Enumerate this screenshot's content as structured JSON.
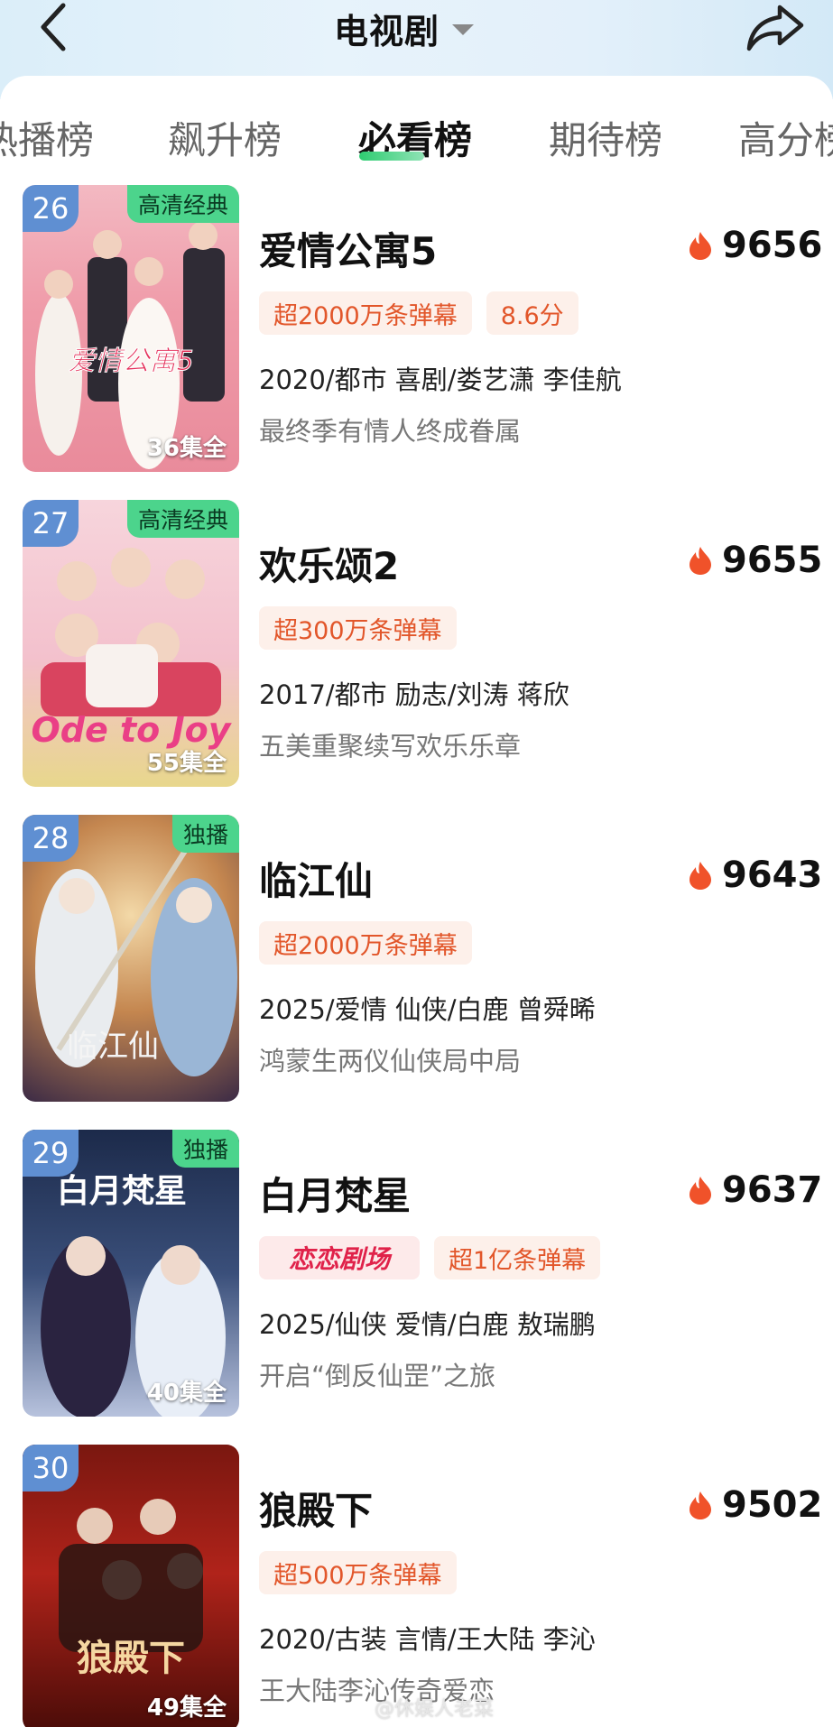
{
  "header": {
    "title": "电视剧"
  },
  "tabs": [
    {
      "label": "热播榜"
    },
    {
      "label": "飙升榜"
    },
    {
      "label": "必看榜"
    },
    {
      "label": "期待榜"
    },
    {
      "label": "高分榜"
    }
  ],
  "active_tab": "必看榜",
  "items": [
    {
      "rank": "26",
      "poster_tag": "高清经典",
      "episodes": "36集全",
      "name": "爱情公寓5",
      "hot": "9656",
      "tags": [
        "超2000万条弹幕",
        "8.6分"
      ],
      "meta": "2020/都市 喜剧/娄艺潇 李佳航",
      "desc": "最终季有情人终成眷属",
      "poster_caption": "爱情公寓5"
    },
    {
      "rank": "27",
      "poster_tag": "高清经典",
      "episodes": "55集全",
      "name": "欢乐颂2",
      "hot": "9655",
      "tags": [
        "超300万条弹幕"
      ],
      "meta": "2017/都市 励志/刘涛 蒋欣",
      "desc": "五美重聚续写欢乐乐章",
      "poster_caption": "Ode to Joy"
    },
    {
      "rank": "28",
      "poster_tag": "独播",
      "episodes": "",
      "name": "临江仙",
      "hot": "9643",
      "tags": [
        "超2000万条弹幕"
      ],
      "meta": "2025/爱情 仙侠/白鹿 曾舜晞",
      "desc": "鸿蒙生两仪仙侠局中局",
      "poster_caption": "临江仙"
    },
    {
      "rank": "29",
      "poster_tag": "独播",
      "episodes": "40集全",
      "name": "白月梵星",
      "hot": "9637",
      "brand_tag": "恋恋剧场",
      "tags": [
        "超1亿条弹幕"
      ],
      "meta": "2025/仙侠 爱情/白鹿 敖瑞鹏",
      "desc": "开启“倒反仙罡”之旅",
      "poster_caption": "白月梵星"
    },
    {
      "rank": "30",
      "poster_tag": "",
      "episodes": "49集全",
      "name": "狼殿下",
      "hot": "9502",
      "tags": [
        "超500万条弹幕"
      ],
      "meta": "2020/古装 言情/王大陆 李沁",
      "desc": "王大陆李沁传奇爱恋",
      "poster_caption": "狼殿下"
    }
  ],
  "watermark": "@休娱人老菜",
  "colors": {
    "accent_green": "#4cd48c",
    "rank_blue": "#5f8fd2",
    "tag_orange": "#e2562a",
    "flame": "#f0522a"
  },
  "icons": [
    "back-arrow-icon",
    "share-icon",
    "flame-icon",
    "dropdown-caret-icon"
  ]
}
